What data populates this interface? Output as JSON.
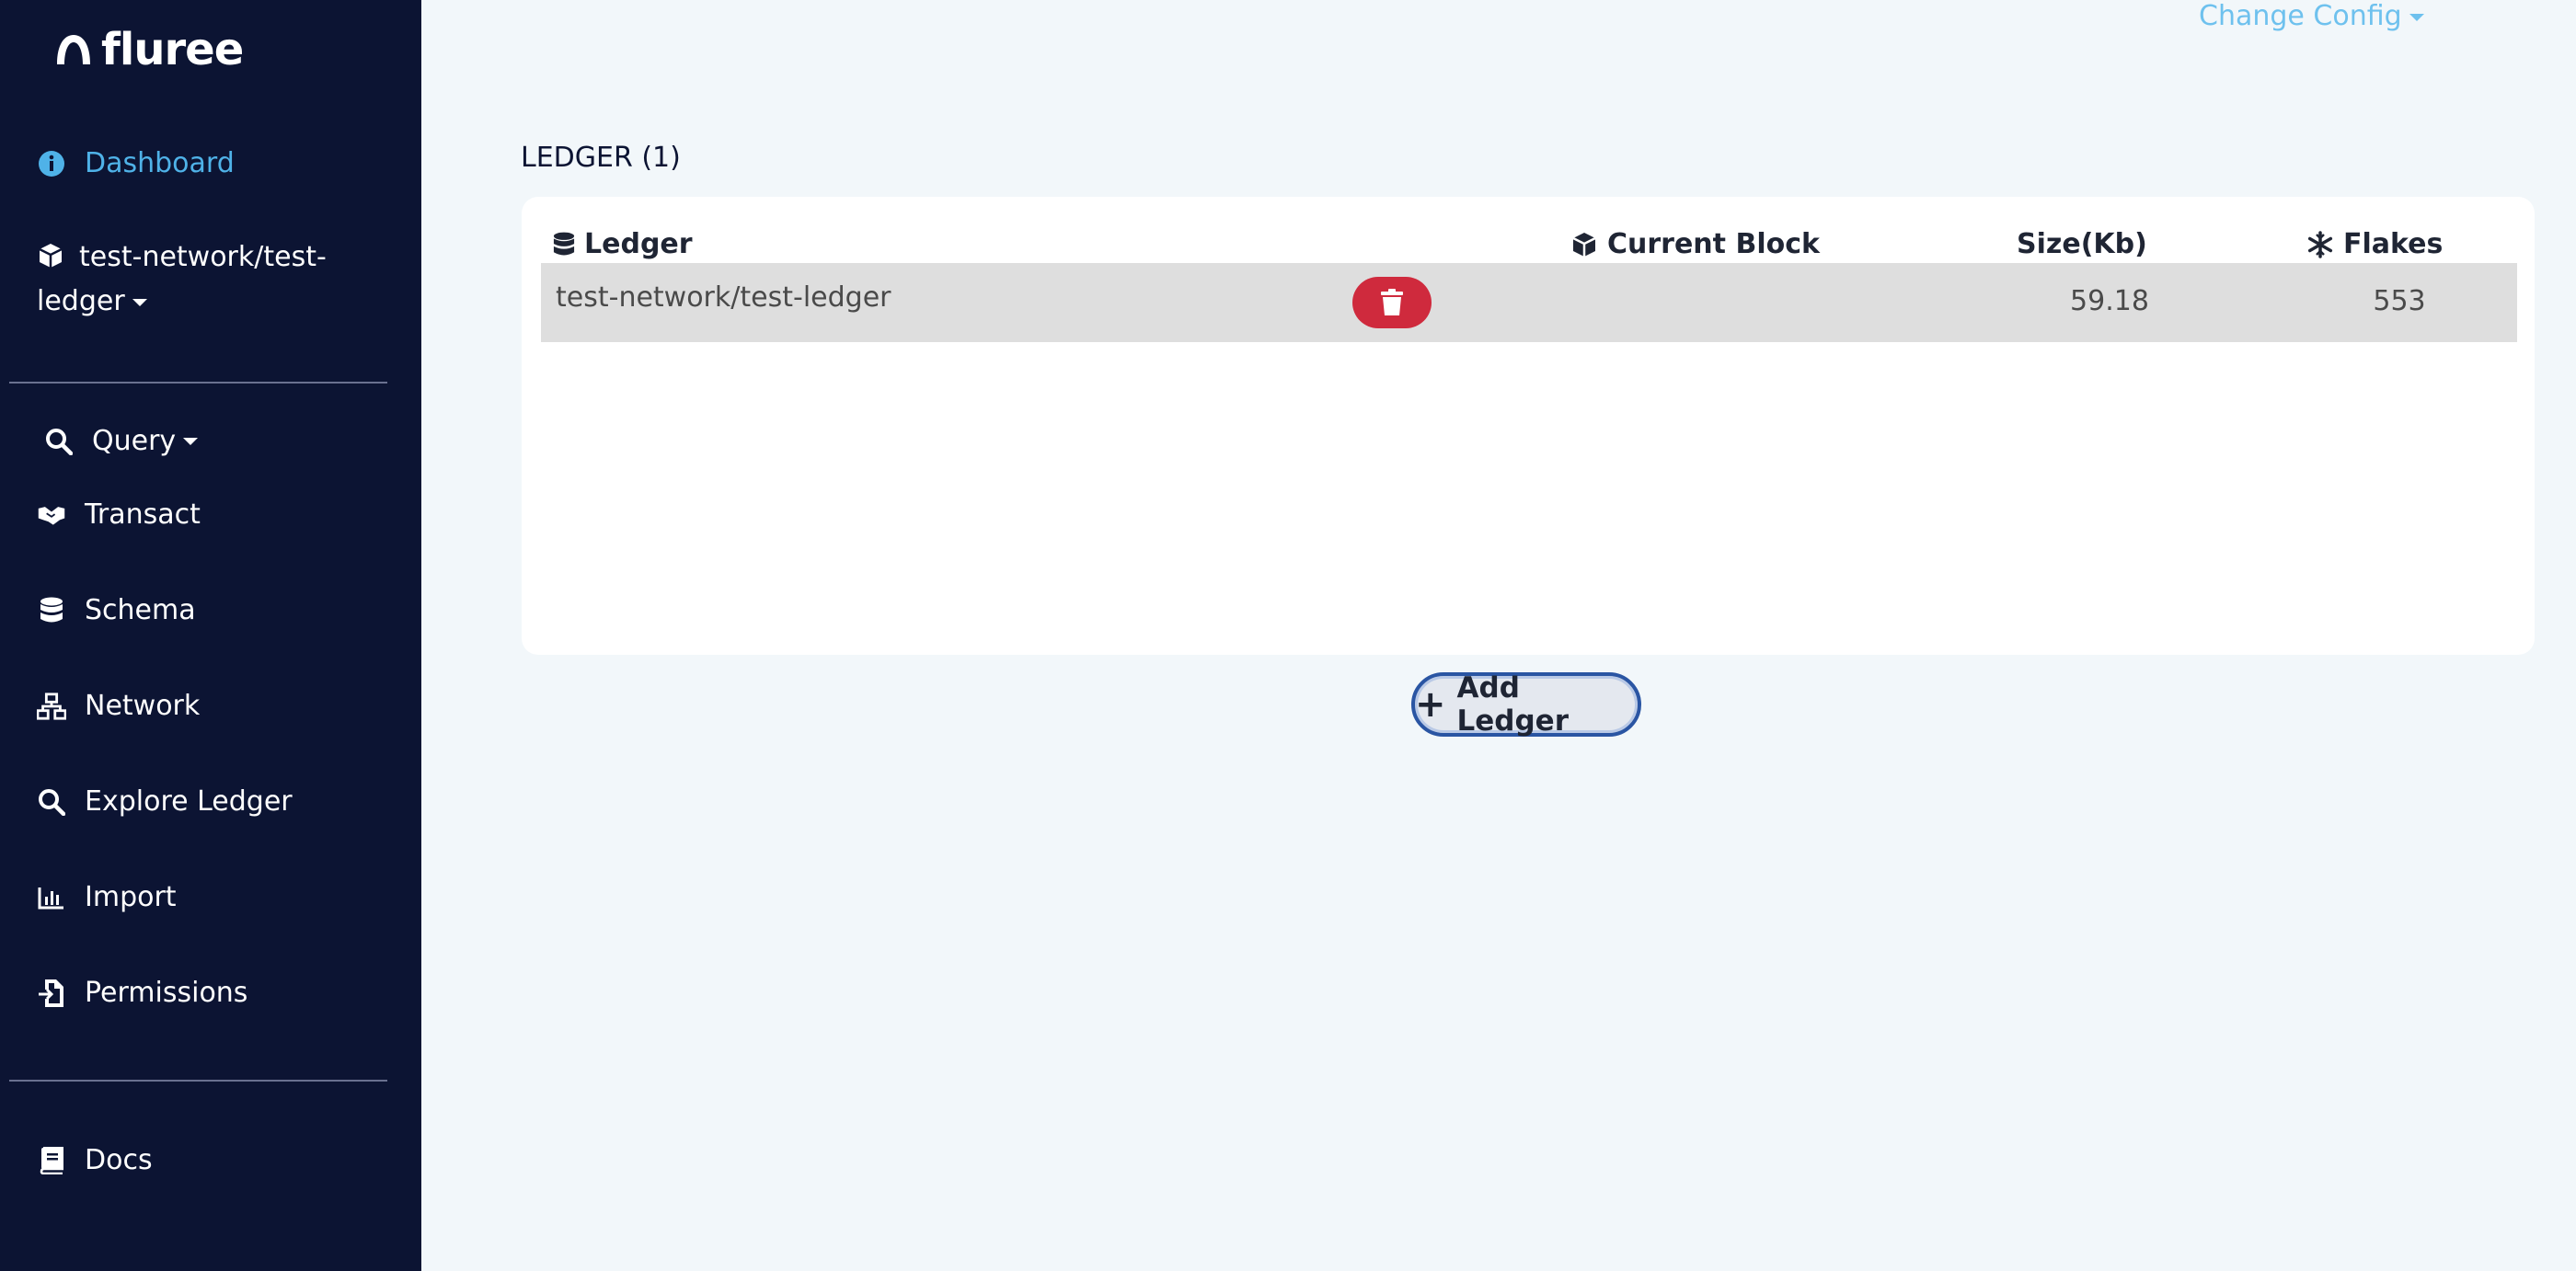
{
  "brand": {
    "name": "fluree"
  },
  "sidebar": {
    "dashboard": "Dashboard",
    "ledger_selector": "test-network/test-ledger",
    "items": [
      {
        "label": "Query",
        "icon": "search-icon"
      },
      {
        "label": "Transact",
        "icon": "handshake-icon"
      },
      {
        "label": "Schema",
        "icon": "database-icon"
      },
      {
        "label": "Network",
        "icon": "network-icon"
      },
      {
        "label": "Explore Ledger",
        "icon": "search-icon"
      },
      {
        "label": "Import",
        "icon": "chart-bar-icon"
      },
      {
        "label": "Permissions",
        "icon": "file-import-icon"
      }
    ],
    "docs": "Docs"
  },
  "header": {
    "change_config": "Change Config"
  },
  "main": {
    "heading": "LEDGER (1)",
    "table": {
      "columns": [
        "Ledger",
        "Current Block",
        "Size(Kb)",
        "Flakes"
      ],
      "rows": [
        {
          "ledger": "test-network/test-ledger",
          "current_block": "",
          "size": "59.18",
          "flakes": "553"
        }
      ]
    },
    "add_button": "Add Ledger"
  },
  "colors": {
    "sidebar_bg": "#0c1433",
    "accent": "#4fb2e8",
    "danger": "#cf2a3d",
    "page_bg": "#f2f7fa"
  }
}
